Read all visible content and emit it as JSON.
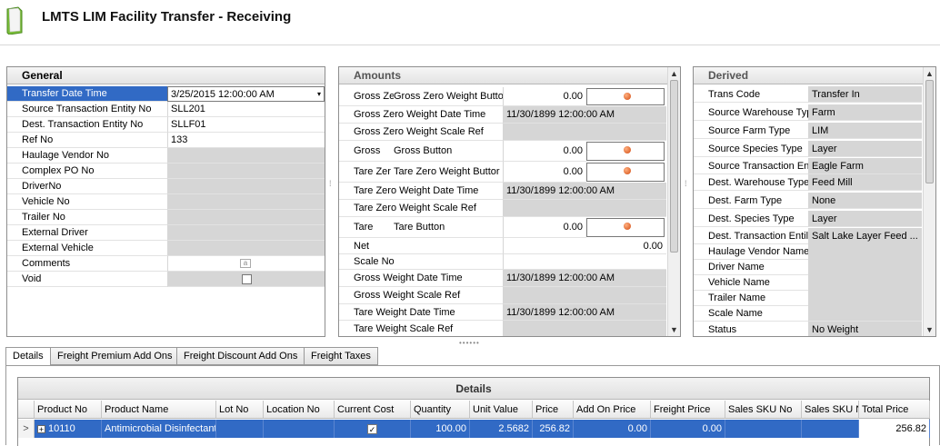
{
  "window": {
    "title": "LMTS LIM Facility Transfer - Receiving",
    "icon": "document-icon"
  },
  "general": {
    "header": "General",
    "rows": [
      {
        "label": "Transfer Date Time",
        "value": "3/25/2015 12:00:00 AM"
      },
      {
        "label": "Source Transaction Entity No",
        "value": "SLL201"
      },
      {
        "label": "Dest. Transaction Entity No",
        "value": "SLLF01"
      },
      {
        "label": "Ref No",
        "value": "133"
      },
      {
        "label": "Haulage Vendor No",
        "value": ""
      },
      {
        "label": "Complex PO No",
        "value": ""
      },
      {
        "label": "DriverNo",
        "value": ""
      },
      {
        "label": "Vehicle No",
        "value": ""
      },
      {
        "label": "Trailer No",
        "value": ""
      },
      {
        "label": "External Driver",
        "value": ""
      },
      {
        "label": "External Vehicle",
        "value": ""
      },
      {
        "label": "Comments",
        "value": ""
      },
      {
        "label": "Void",
        "value": ""
      }
    ]
  },
  "amounts": {
    "header": "Amounts",
    "rows": [
      {
        "label": "Gross Ze",
        "button_label": "Gross Zero Weight Butto",
        "value": "0.00"
      },
      {
        "label": "Gross Zero Weight Date Time",
        "value": "11/30/1899 12:00:00 AM"
      },
      {
        "label": "Gross Zero Weight Scale Ref",
        "value": ""
      },
      {
        "label": "Gross",
        "button_label": "Gross Button",
        "value": "0.00"
      },
      {
        "label": "Tare Zer",
        "button_label": "Tare Zero Weight Buttor",
        "value": "0.00"
      },
      {
        "label": "Tare Zero Weight Date Time",
        "value": "11/30/1899 12:00:00 AM"
      },
      {
        "label": "Tare Zero Weight Scale Ref",
        "value": ""
      },
      {
        "label": "Tare",
        "button_label": "Tare Button",
        "value": "0.00"
      },
      {
        "label": "Net",
        "value": "0.00"
      },
      {
        "label": "Scale No",
        "value": ""
      },
      {
        "label": "Gross Weight Date Time",
        "value": "11/30/1899 12:00:00 AM"
      },
      {
        "label": "Gross Weight Scale Ref",
        "value": ""
      },
      {
        "label": "Tare Weight Date Time",
        "value": "11/30/1899 12:00:00 AM"
      },
      {
        "label": "Tare Weight Scale Ref",
        "value": ""
      }
    ]
  },
  "derived": {
    "header": "Derived",
    "rows": [
      {
        "label": "Trans Code",
        "value": "Transfer In"
      },
      {
        "label": "Source Warehouse Typ",
        "value": "Farm"
      },
      {
        "label": "Source Farm Type",
        "value": "LIM"
      },
      {
        "label": "Source Species Type",
        "value": "Layer"
      },
      {
        "label": "Source Transaction En",
        "value": "Eagle Farm"
      },
      {
        "label": "Dest. Warehouse Type",
        "value": "Feed Mill"
      },
      {
        "label": "Dest. Farm Type",
        "value": "None"
      },
      {
        "label": "Dest. Species Type",
        "value": "Layer"
      },
      {
        "label": "Dest. Transaction Entil",
        "value": "Salt Lake Layer Feed ..."
      },
      {
        "label": "Haulage Vendor Name",
        "value": ""
      },
      {
        "label": "Driver Name",
        "value": ""
      },
      {
        "label": "Vehicle Name",
        "value": ""
      },
      {
        "label": "Trailer Name",
        "value": ""
      },
      {
        "label": "Scale Name",
        "value": ""
      },
      {
        "label": "Status",
        "value": "No Weight"
      }
    ]
  },
  "tabs": [
    "Details",
    "Freight Premium Add Ons",
    "Freight Discount Add Ons",
    "Freight Taxes"
  ],
  "details": {
    "title": "Details",
    "columns": [
      "Product No",
      "Product Name",
      "Lot No",
      "Location No",
      "Current Cost",
      "Quantity",
      "Unit Value",
      "Price",
      "Add On Price",
      "Freight Price",
      "Sales SKU No",
      "Sales SKU N",
      "Total Price"
    ],
    "rows": [
      [
        "10110",
        "Antimicrobial Disinfectant",
        "",
        "",
        "",
        "100.00",
        "2.5682",
        "256.82",
        "0.00",
        "0.00",
        "",
        "",
        "256.82"
      ]
    ],
    "row_indicator": ">",
    "expand_glyph": "+",
    "checkbox_glyph": "✓"
  },
  "colors": {
    "selection": "#316ac5",
    "readonly": "#d6d6d6",
    "weigh_dot": "#e05a1a"
  }
}
